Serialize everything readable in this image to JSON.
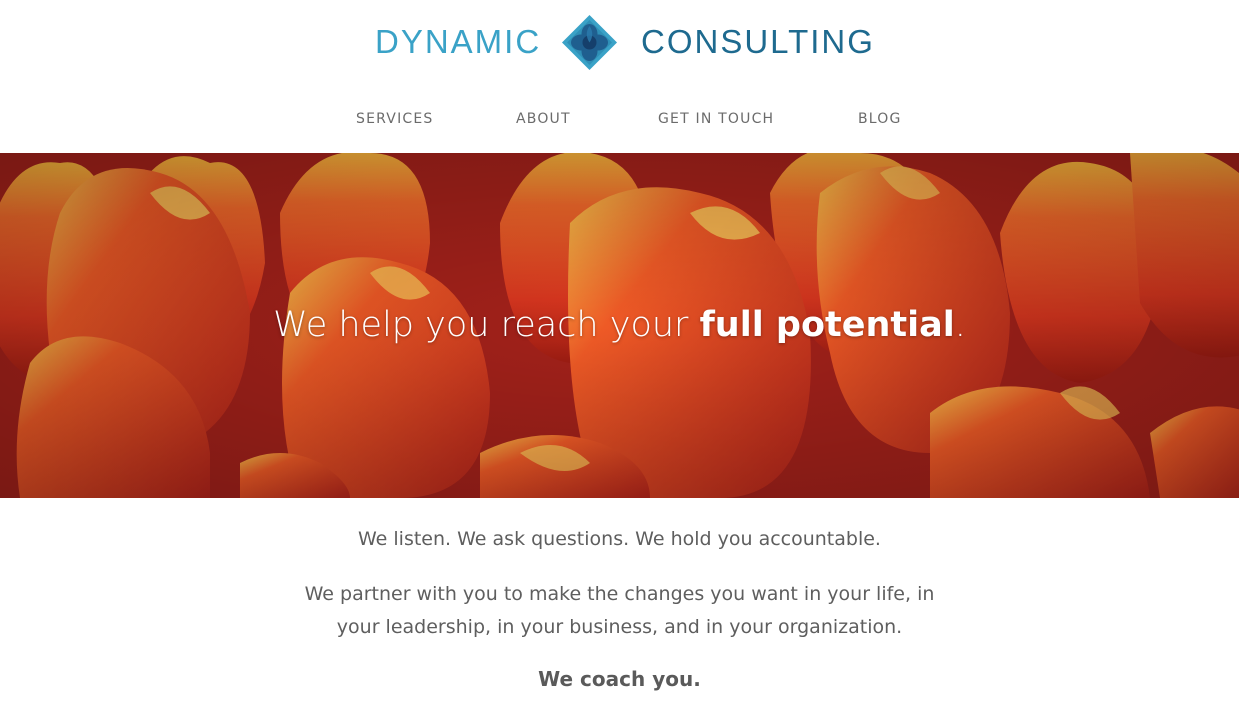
{
  "brand": {
    "name_left": "DYNAMIC",
    "name_right": "CONSULTING",
    "logo_icon": "diamond-flower-icon",
    "colors": {
      "light_blue": "#3aa2c7",
      "dark_blue": "#1e6a8f"
    }
  },
  "nav": {
    "items": [
      {
        "label": "SERVICES"
      },
      {
        "label": "ABOUT"
      },
      {
        "label": "GET IN TOUCH"
      },
      {
        "label": "BLOG"
      }
    ]
  },
  "hero": {
    "tagline_prefix": "We help you reach your ",
    "tagline_emphasis": "full potential",
    "tagline_suffix": ".",
    "image_subject": "orange-red tulips"
  },
  "content": {
    "line1": "We listen. We ask questions. We hold you accountable.",
    "line2a": "We partner with you to make the changes you want in your life, in",
    "line2b": "your leadership, in your business, and in your organization.",
    "line3": "We coach you."
  }
}
